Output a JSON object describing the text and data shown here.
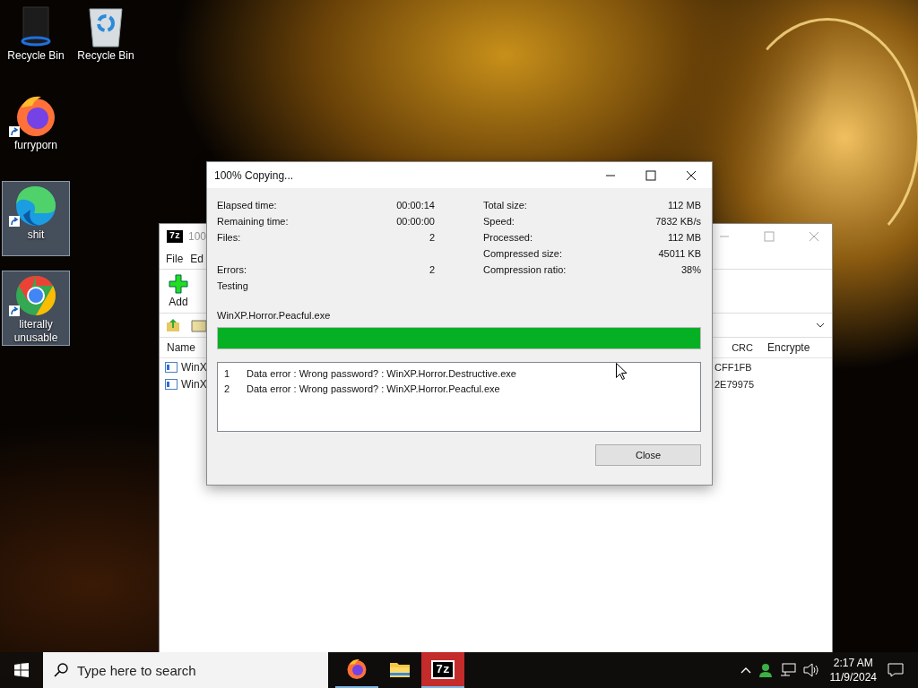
{
  "desktop_icons": [
    {
      "label": "Recycle Bin",
      "kind": "bin-dark",
      "selected": false,
      "shortcut": false
    },
    {
      "label": "Recycle Bin",
      "kind": "bin",
      "selected": false,
      "shortcut": false
    },
    {
      "label": "furryporn",
      "kind": "firefox",
      "selected": false,
      "shortcut": true
    },
    {
      "label": "shit",
      "kind": "edge",
      "selected": true,
      "shortcut": true
    },
    {
      "label": "literally unusable",
      "kind": "chrome",
      "selected": true,
      "shortcut": true
    }
  ],
  "back_window": {
    "logo": "7z",
    "title": "100",
    "menu": [
      "File",
      "Ed"
    ],
    "toolbar": [
      "Add"
    ],
    "columns": [
      "Name",
      "CRC",
      "Encrypte"
    ],
    "rows": [
      {
        "name": "WinX",
        "crc": "CFF1FB"
      },
      {
        "name": "WinX",
        "crc": "2E79975"
      }
    ]
  },
  "dialog": {
    "title": "100% Copying...",
    "stats": [
      {
        "left_label": "Elapsed time:",
        "left_value": "00:00:14",
        "right_label": "Total size:",
        "right_value": "112 MB"
      },
      {
        "left_label": "Remaining time:",
        "left_value": "00:00:00",
        "right_label": "Speed:",
        "right_value": "7832 KB/s"
      },
      {
        "left_label": "Files:",
        "left_value": "2",
        "right_label": "Processed:",
        "right_value": "112 MB"
      },
      {
        "right_label": "Compressed size:",
        "right_value": "45011 KB"
      },
      {
        "left_label": "Errors:",
        "left_value": "2",
        "right_label": "Compression ratio:",
        "right_value": "38%"
      }
    ],
    "operation": "Testing",
    "current_file": "WinXP.Horror.Peacful.exe",
    "level": 1,
    "log": [
      {
        "number": "1",
        "message": "Data error : Wrong password? : WinXP.Horror.Destructive.exe"
      },
      {
        "number": "2",
        "message": "Data error : Wrong password? : WinXP.Horror.Peacful.exe"
      }
    ],
    "button": "Close"
  },
  "taskbar": {
    "search_placeholder": "Type here to search",
    "apps": [
      {
        "kind": "firefox",
        "running": true,
        "active": false
      },
      {
        "kind": "explorer",
        "running": false,
        "active": false
      },
      {
        "kind": "archiver",
        "label": "7z",
        "running": true,
        "active": true
      }
    ],
    "time": "2:17 AM",
    "date": "11/9/2024"
  }
}
